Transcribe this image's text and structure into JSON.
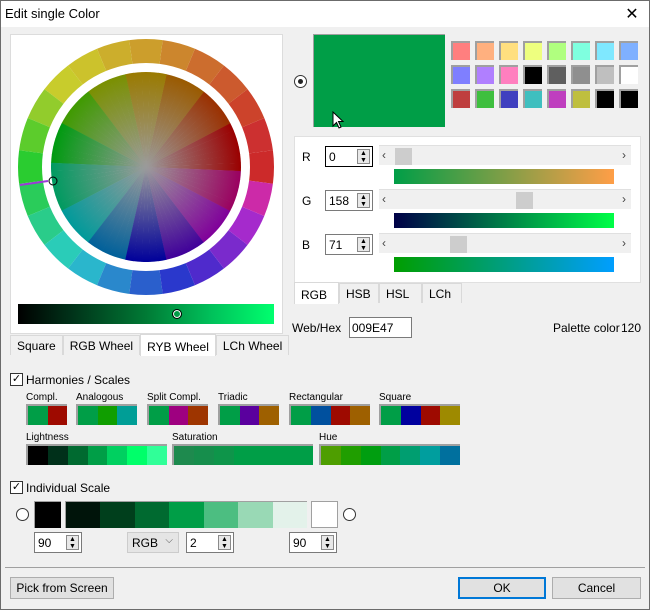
{
  "window": {
    "title": "Edit single Color",
    "close_icon": "close-icon"
  },
  "current_color": {
    "hex": "#009E47",
    "r": "0",
    "g": "158",
    "b": "71",
    "web_hex": "009E47"
  },
  "palette": [
    [
      "#ff7f7f",
      "#ffb07f",
      "#ffdf7f",
      "#eeff7f",
      "#b0ff7f",
      "#7fffdf",
      "#7fe8ff",
      "#7fb0ff"
    ],
    [
      "#7f7fff",
      "#b07fff",
      "#ff7fbf",
      "#000000",
      "#5f5f5f",
      "#8f8f8f",
      "#bfbfbf",
      "#ffffff"
    ],
    [
      "#bf3f3f",
      "#3fbf3f",
      "#3f3fbf",
      "#3fbfbf",
      "#bf3fbf",
      "#bfbf3f",
      "#000000",
      "#000000"
    ]
  ],
  "wheel": {
    "segments": [
      "#cc2a2a",
      "#cc3030",
      "#cc432b",
      "#cc5a2e",
      "#cc6d2e",
      "#cc862d",
      "#cc9e2c",
      "#ccae2c",
      "#ccc22c",
      "#c8cc2c",
      "#92cc2c",
      "#5ccc2c",
      "#2acc30",
      "#2acc5a",
      "#2acc8a",
      "#2accb8",
      "#2ab6cc",
      "#2a88cc",
      "#2a5fcc",
      "#2a38cc",
      "#4f2acc",
      "#7a2acc",
      "#a52acc",
      "#cc2aa8"
    ],
    "tabs": [
      {
        "label": "Square",
        "active": false
      },
      {
        "label": "RGB Wheel",
        "active": false
      },
      {
        "label": "RYB Wheel",
        "active": true
      },
      {
        "label": "LCh Wheel",
        "active": false
      }
    ],
    "brightness_position": 0.62
  },
  "sliders": [
    {
      "label": "R",
      "value": "0",
      "fraction": 0.0,
      "gradient": [
        "#009e47",
        "#ff9e47"
      ]
    },
    {
      "label": "G",
      "value": "158",
      "fraction": 0.62,
      "gradient": [
        "#000047",
        "#00ff47"
      ]
    },
    {
      "label": "B",
      "value": "71",
      "fraction": 0.28,
      "gradient": [
        "#009e00",
        "#009eff"
      ]
    }
  ],
  "model_tabs": [
    {
      "label": "RGB",
      "active": true
    },
    {
      "label": "HSB",
      "active": false
    },
    {
      "label": "HSL",
      "active": false
    },
    {
      "label": "LCh",
      "active": false
    }
  ],
  "web_hex_label": "Web/Hex",
  "palette_color_label": "Palette color",
  "palette_color_value": "120",
  "harmonies": {
    "label": "Harmonies / Scales",
    "checked": true,
    "groups": [
      {
        "label": "Compl.",
        "colors": [
          "#009e47",
          "#9e0a00"
        ]
      },
      {
        "label": "Analogous",
        "colors": [
          "#009e47",
          "#109e00",
          "#009e96"
        ]
      },
      {
        "label": "Split Compl.",
        "colors": [
          "#009e47",
          "#9e0080",
          "#9e3500"
        ]
      },
      {
        "label": "Triadic",
        "colors": [
          "#009e47",
          "#5a009e",
          "#9e6000"
        ]
      },
      {
        "label": "Rectangular",
        "colors": [
          "#009e47",
          "#00509e",
          "#9e0a00",
          "#9e6000"
        ]
      },
      {
        "label": "Square",
        "colors": [
          "#009e47",
          "#00009e",
          "#9e0a00",
          "#9e8a00"
        ]
      }
    ],
    "scales": [
      {
        "label": "Lightness",
        "colors": [
          "#000000",
          "#00301a",
          "#006a30",
          "#009e47",
          "#00d060",
          "#00ff6a",
          "#30ff98"
        ]
      },
      {
        "label": "Saturation",
        "colors": [
          "#1e8a4e",
          "#168e4c",
          "#0e954a",
          "#009e47",
          "#009e47",
          "#009e47",
          "#009e47"
        ]
      },
      {
        "label": "Hue",
        "colors": [
          "#4e9e00",
          "#209e00",
          "#009e10",
          "#009e47",
          "#009e70",
          "#009e9e",
          "#00709e"
        ]
      }
    ]
  },
  "individual_scale": {
    "label": "Individual Scale",
    "checked": true,
    "start_color": "#000000",
    "end_color": "#ffffff",
    "colors": [
      "#00140a",
      "#003f1c",
      "#006a30",
      "#009e47",
      "#4cbe81",
      "#99d9b5",
      "#e3f2ea"
    ],
    "left_value": "90",
    "mode": "RGB",
    "steps": "2",
    "right_value": "90"
  },
  "buttons": {
    "pick_from_screen": "Pick from Screen",
    "ok": "OK",
    "cancel": "Cancel"
  }
}
